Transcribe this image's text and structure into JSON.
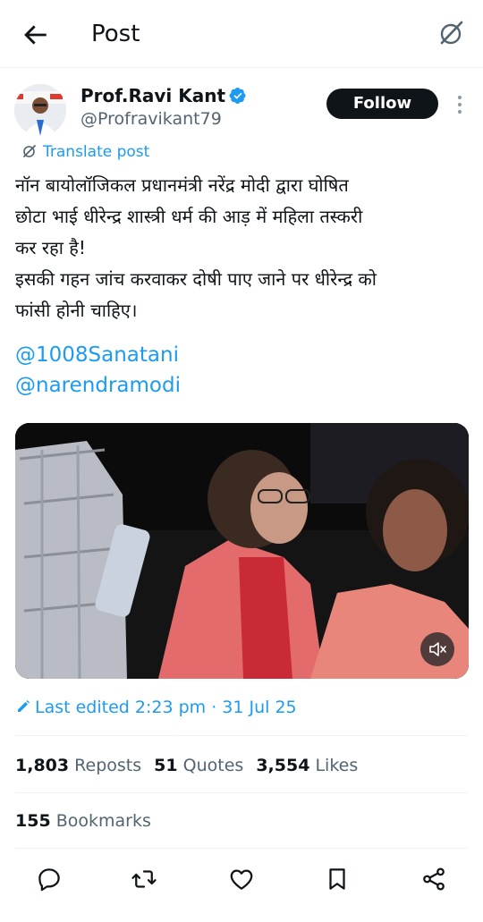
{
  "header": {
    "title": "Post",
    "back_icon": "arrow-left-icon",
    "grok_icon": "grok-icon"
  },
  "author": {
    "name": "Prof.Ravi Kant",
    "handle": "@Profravikant79",
    "verified": true,
    "follow_label": "Follow"
  },
  "translate_label": "Translate post",
  "tweet": {
    "lines": [
      "नॉन बायोलॉजिकल प्रधानमंत्री नरेंद्र मोदी द्वारा घोषित",
      "छोटा भाई धीरेन्द्र शास्त्री धर्म की आड़ में महिला तस्करी",
      "कर रहा है!",
      "इसकी गहन जांच करवाकर दोषी पाए जाने पर धीरेन्द्र को",
      "फांसी होनी चाहिए।"
    ],
    "mentions": [
      "@1008Sanatani",
      "@narendramodi"
    ]
  },
  "edited_label": "Last edited 2:23 pm · 31 Jul 25",
  "stats": {
    "reposts_count": "1,803",
    "reposts_label": "Reposts",
    "quotes_count": "51",
    "quotes_label": "Quotes",
    "likes_count": "3,554",
    "likes_label": "Likes",
    "bookmarks_count": "155",
    "bookmarks_label": "Bookmarks"
  },
  "colors": {
    "accent": "#1d9bf0",
    "text": "#0f1419",
    "secondary": "#536471",
    "divider": "#eff3f4"
  }
}
